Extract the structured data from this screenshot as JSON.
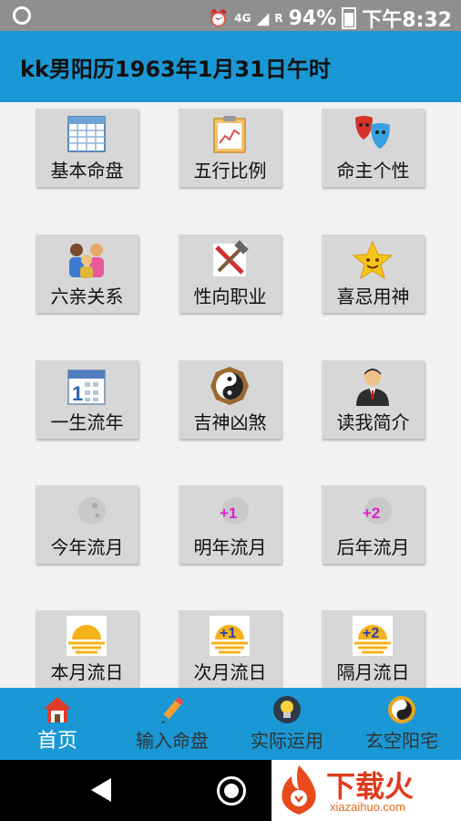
{
  "status_bar": {
    "network_label": "4G",
    "roaming_label": "R",
    "battery": "94%",
    "time": "下午8:32"
  },
  "header": {
    "title": "kk男阳历1963年1月31日午时"
  },
  "menu_tiles": [
    {
      "label": "基本命盘",
      "icon": "table-icon"
    },
    {
      "label": "五行比例",
      "icon": "clipboard-chart-icon"
    },
    {
      "label": "命主个性",
      "icon": "theater-masks-icon"
    },
    {
      "label": "六亲关系",
      "icon": "family-icon"
    },
    {
      "label": "性向职业",
      "icon": "tools-icon"
    },
    {
      "label": "喜忌用神",
      "icon": "star-icon"
    },
    {
      "label": "一生流年",
      "icon": "calendar-icon"
    },
    {
      "label": "吉神凶煞",
      "icon": "yin-yang-icon"
    },
    {
      "label": "读我简介",
      "icon": "person-icon"
    },
    {
      "label": "今年流月",
      "icon": "moon-phase-icon"
    },
    {
      "label": "明年流月",
      "icon": "moon-phase-plus1-icon",
      "badge": "+1"
    },
    {
      "label": "后年流月",
      "icon": "moon-phase-plus2-icon",
      "badge": "+2"
    },
    {
      "label": "本月流日",
      "icon": "sunrise-icon"
    },
    {
      "label": "次月流日",
      "icon": "sunrise-plus1-icon",
      "badge": "+1"
    },
    {
      "label": "隔月流日",
      "icon": "sunrise-plus2-icon",
      "badge": "+2"
    }
  ],
  "tab_bar": [
    {
      "label": "首页",
      "icon": "home-icon",
      "active": true
    },
    {
      "label": "输入命盘",
      "icon": "pencil-icon",
      "active": false
    },
    {
      "label": "实际运用",
      "icon": "lightbulb-icon",
      "active": false
    },
    {
      "label": "玄空阳宅",
      "icon": "yin-yang-icon",
      "active": false
    }
  ],
  "watermark": {
    "brand": "下载火",
    "url": "xiazaihuo.com"
  },
  "colors": {
    "accent": "#1a98d5",
    "tile": "#d7d7d7",
    "status_bar": "#8f8f8f"
  }
}
